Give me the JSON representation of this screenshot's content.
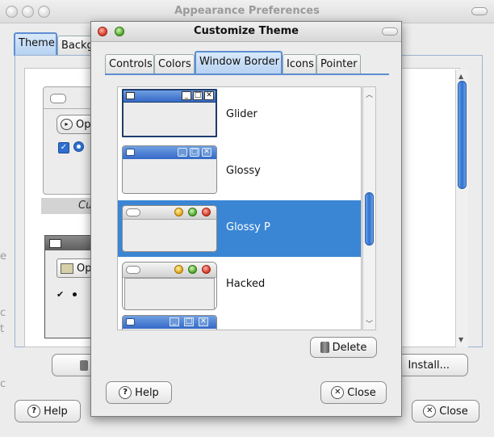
{
  "background_window": {
    "title": "Appearance Preferences",
    "tabs": [
      {
        "label": "Theme",
        "selected": true
      },
      {
        "label": "Backg",
        "selected": false
      }
    ],
    "preview_partial": {
      "button_label": "Op",
      "caption": "Cu",
      "button_label_2": "Op"
    },
    "install_button": "Install...",
    "help_button": "Help",
    "close_button": "Close"
  },
  "dialog": {
    "title": "Customize Theme",
    "tabs": [
      {
        "label": "Controls",
        "selected": false
      },
      {
        "label": "Colors",
        "selected": false
      },
      {
        "label": "Window Border",
        "selected": true
      },
      {
        "label": "Icons",
        "selected": false
      },
      {
        "label": "Pointer",
        "selected": false
      }
    ],
    "themes": [
      {
        "name": "Glider",
        "selected": false
      },
      {
        "name": "Glossy",
        "selected": false
      },
      {
        "name": "Glossy P",
        "selected": true
      },
      {
        "name": "Hacked",
        "selected": false
      },
      {
        "name": "",
        "selected": false
      }
    ],
    "delete_button": "Delete",
    "help_button": "Help",
    "close_button": "Close"
  },
  "colors": {
    "selection": "#3a86d4",
    "accent": "#5d8ed0",
    "titlebar_blue": "#3569c6"
  }
}
